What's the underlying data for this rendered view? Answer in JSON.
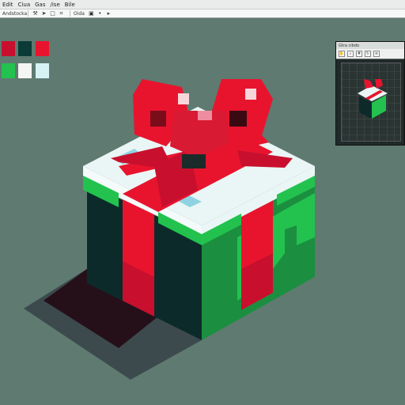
{
  "menu": {
    "items": [
      "Edit",
      "Ciua",
      "Gas",
      "/ise",
      "Bile"
    ]
  },
  "toolbar": {
    "label": "Andstocka",
    "text_item": "Oida",
    "icons": [
      "tool-icon",
      "pointer-icon",
      "square-icon",
      "crop-icon",
      "select-icon",
      "dot-icon",
      "play-icon"
    ]
  },
  "palette": {
    "colors": [
      "#c8102e",
      "#0b3b36",
      "#e8142e",
      "#23c24f",
      "#f4f6f4",
      "#d6f2f5"
    ]
  },
  "preview": {
    "title": "Gtra cibdo",
    "tools": [
      "hand-icon",
      "zoom-icon",
      "grid-icon",
      "refresh-icon",
      "layers-icon"
    ]
  },
  "colors": {
    "background": "#5f7a70",
    "ribbon": "#e8142e",
    "ribbon_dark": "#b00f26",
    "box_green": "#23c24f",
    "box_dark": "#0d2a2a",
    "lid_white": "#e9f6f5",
    "lid_cyan": "#8fd3e2"
  }
}
